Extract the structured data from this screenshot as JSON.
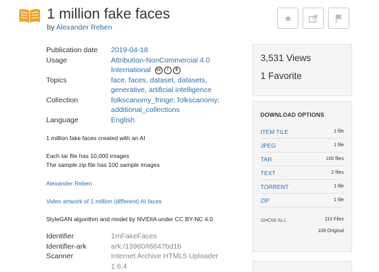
{
  "header": {
    "title": "1 million fake faces",
    "by_prefix": "by",
    "author": "Alexander Reben"
  },
  "metadata": [
    {
      "key": "Publication date",
      "value": "2019-04-18"
    },
    {
      "key": "Usage",
      "value": "Attribution-NonCommercial 4.0",
      "value2": "International"
    },
    {
      "key": "Topics",
      "value": "face, faces, dataset, datasets,",
      "value2": "generative, artificial intelligence"
    },
    {
      "key": "Collection",
      "value": "folkscanomy_fringe; folkscanomy;",
      "value2": "additional_collections"
    },
    {
      "key": "Language",
      "value": "English"
    }
  ],
  "description": {
    "line1": "1 million fake faces created with an AI",
    "line2": "Each tar file has 10,000 images",
    "line3": "The sample zip file has 100 sample images",
    "link1": "Alexander Reben",
    "link2": "Video artwork of 1 million (different) AI faces",
    "line4": "StyleGAN algorithm and model by NVIDIA under CC BY-NC 4.0"
  },
  "identifiers": [
    {
      "key": "Identifier",
      "value": "1mFakeFaces"
    },
    {
      "key": "Identifier-ark",
      "value": "ark:/13960/t6647bd1b"
    },
    {
      "key": "Scanner",
      "value": "Internet Archive HTML5 Uploader",
      "value2": "1.6.4"
    }
  ],
  "stats": {
    "views": "3,531 Views",
    "favorites": "1 Favorite"
  },
  "downloads": {
    "title": "DOWNLOAD OPTIONS",
    "items": [
      {
        "format": "ITEM TILE",
        "count": "1 file"
      },
      {
        "format": "JPEG",
        "count": "1 file"
      },
      {
        "format": "TAR",
        "count": "100 files"
      },
      {
        "format": "TEXT",
        "count": "2 files"
      },
      {
        "format": "TORRENT",
        "count": "1 file"
      },
      {
        "format": "ZIP",
        "count": "1 file"
      }
    ],
    "show_all": "SHOW ALL",
    "total": "110 Files",
    "original": "109 Original"
  },
  "colors": {
    "accent": "#f0a02a",
    "link": "#2c6fb0"
  }
}
